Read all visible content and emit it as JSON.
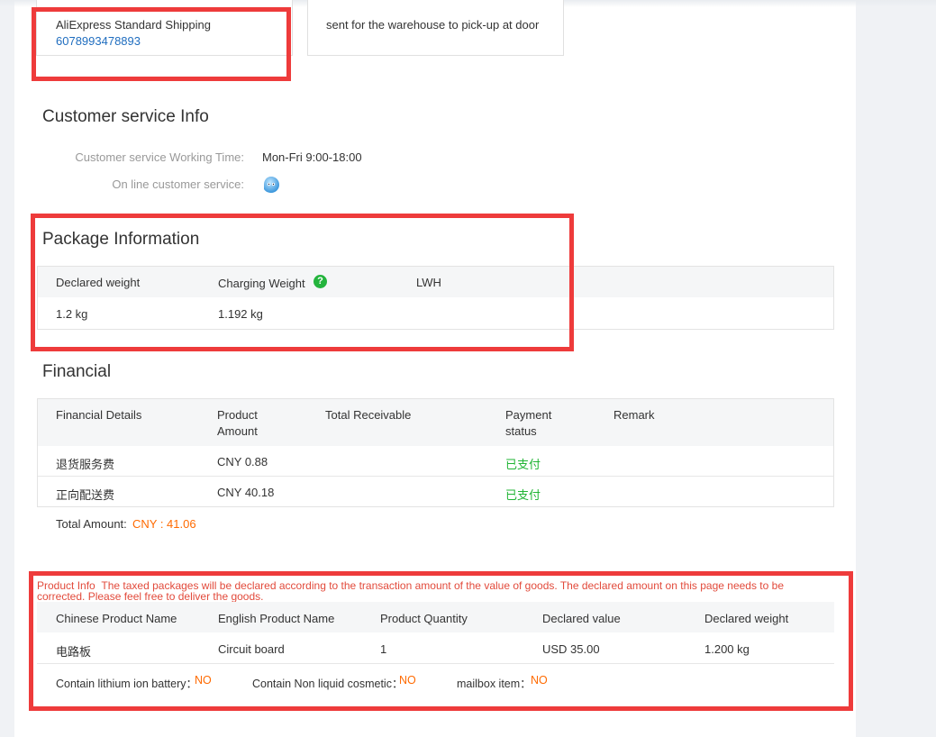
{
  "shipping": {
    "method": "AliExpress Standard Shipping",
    "tracking_number": "6078993478893",
    "pickup_note": "sent for the warehouse to pick-up at door"
  },
  "customer_service": {
    "title": "Customer service Info",
    "working_time_label": "Customer service Working Time:",
    "working_time_value": "Mon-Fri 9:00-18:00",
    "online_label": "On line customer service:",
    "online_icon": "chat-bubble-icon"
  },
  "package": {
    "title": "Package Information",
    "headers": {
      "declared_weight": "Declared weight",
      "charging_weight": "Charging Weight",
      "lwh": "LWH"
    },
    "help_icon_glyph": "?",
    "values": {
      "declared_weight": "1.2 kg",
      "charging_weight": "1.192 kg",
      "lwh": ""
    }
  },
  "financial": {
    "title": "Financial",
    "headers": {
      "details": "Financial Details",
      "product_amount_l1": "Product",
      "product_amount_l2": "Amount",
      "total_receivable": "Total Receivable",
      "payment_status_l1": "Payment",
      "payment_status_l2": "status",
      "remark": "Remark"
    },
    "rows": [
      {
        "details": "退货服务费",
        "product_amount": "CNY 0.88",
        "total_receivable": "",
        "payment_status": "已支付",
        "remark": ""
      },
      {
        "details": "正向配送费",
        "product_amount": "CNY 40.18",
        "total_receivable": "",
        "payment_status": "已支付",
        "remark": ""
      }
    ],
    "total_label": "Total Amount:",
    "total_value": "CNY : 41.06"
  },
  "product_info": {
    "label": "Product Info",
    "notice": "The taxed packages will be declared according to the transaction amount of the value of goods. The declared amount on this page needs to be corrected. Please feel free to deliver the goods.",
    "notice_line1": "The taxed packages will be declared according to the transaction amount of the value of goods. The declared amount on this page needs to be",
    "notice_line2": "corrected. Please feel free to deliver the goods.",
    "headers": {
      "chinese_name": "Chinese Product Name",
      "english_name": "English Product Name",
      "quantity": "Product Quantity",
      "declared_value": "Declared value",
      "declared_weight": "Declared weight"
    },
    "row": {
      "chinese_name": "电路板",
      "english_name": "Circuit board",
      "quantity": "1",
      "declared_value": "USD 35.00",
      "declared_weight": "1.200 kg"
    },
    "flags": {
      "lithium_label": "Contain lithium ion battery：",
      "lithium_value": "NO",
      "cosmetic_label": "Contain Non liquid cosmetic：",
      "cosmetic_value": "NO",
      "mailbox_label": "mailbox item：",
      "mailbox_value": "NO"
    }
  },
  "colors": {
    "highlight_outline": "#ee3b3b",
    "paid_green": "#21b534",
    "amount_orange": "#ff6a00",
    "link_blue": "#1f6dbf"
  }
}
